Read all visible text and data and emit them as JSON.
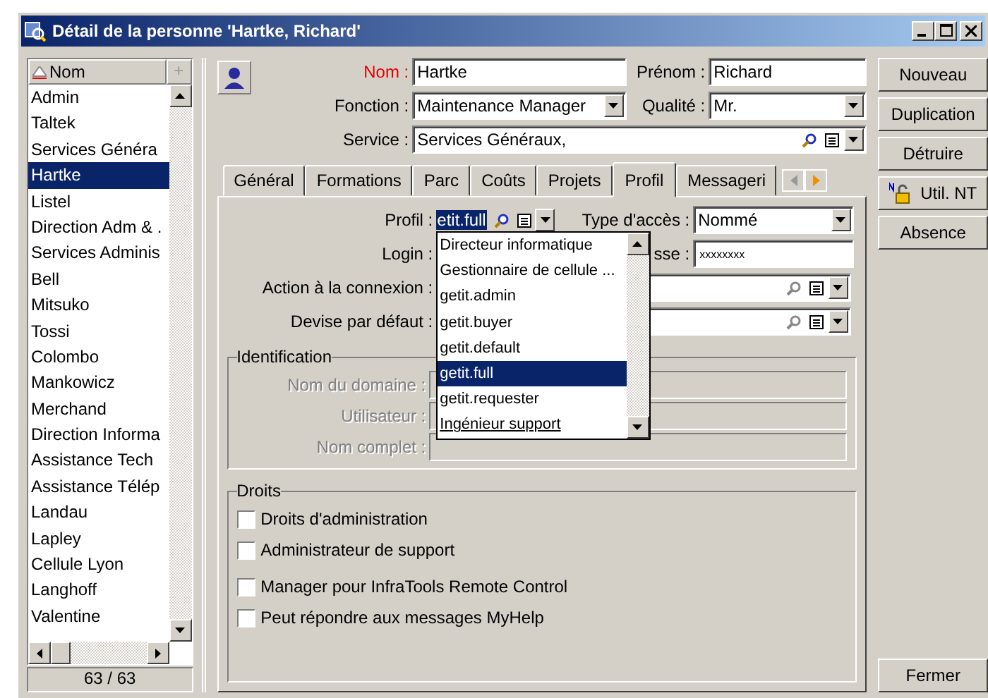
{
  "window": {
    "title": "Détail de la personne 'Hartke, Richard'"
  },
  "list": {
    "header": "Nom",
    "add_mark": "+",
    "counter": "63 / 63",
    "items": [
      {
        "label": "Admin",
        "selected": false
      },
      {
        "label": "Taltek",
        "selected": false
      },
      {
        "label": "Services Généra",
        "selected": false
      },
      {
        "label": "Hartke",
        "selected": true
      },
      {
        "label": "Listel",
        "selected": false
      },
      {
        "label": "Direction Adm & .",
        "selected": false
      },
      {
        "label": "Services Adminis",
        "selected": false
      },
      {
        "label": "Bell",
        "selected": false
      },
      {
        "label": "Mitsuko",
        "selected": false
      },
      {
        "label": "Tossi",
        "selected": false
      },
      {
        "label": "Colombo",
        "selected": false
      },
      {
        "label": "Mankowicz",
        "selected": false
      },
      {
        "label": "Merchand",
        "selected": false
      },
      {
        "label": "Direction Informa",
        "selected": false
      },
      {
        "label": "Assistance Tech",
        "selected": false
      },
      {
        "label": "Assistance Télép",
        "selected": false
      },
      {
        "label": "Landau",
        "selected": false
      },
      {
        "label": "Lapley",
        "selected": false
      },
      {
        "label": "Cellule Lyon",
        "selected": false
      },
      {
        "label": "Langhoff",
        "selected": false
      },
      {
        "label": "Valentine",
        "selected": false
      }
    ]
  },
  "header_fields": [
    [
      {
        "label": "Nom :",
        "value": "Hartke",
        "kind": "text",
        "required": true
      },
      {
        "label": "Prénom :",
        "value": "Richard",
        "kind": "text",
        "required": false
      }
    ],
    [
      {
        "label": "Fonction :",
        "value": "Maintenance Manager",
        "kind": "combo",
        "required": false
      },
      {
        "label": "Qualité :",
        "value": "Mr.",
        "kind": "combo",
        "required": false
      }
    ],
    [
      {
        "label": "Service :",
        "value": "Services Généraux,",
        "kind": "link",
        "required": false
      }
    ]
  ],
  "tabs": [
    {
      "label": "Général",
      "selected": false
    },
    {
      "label": "Formations",
      "selected": false
    },
    {
      "label": "Parc",
      "selected": false
    },
    {
      "label": "Coûts",
      "selected": false
    },
    {
      "label": "Projets",
      "selected": false
    },
    {
      "label": "Profil",
      "selected": true
    },
    {
      "label": "Messageri",
      "selected": false
    }
  ],
  "profile": {
    "profil_label": "Profil :",
    "profil_value": "etit.full",
    "access_label": "Type d'accès :",
    "access_value": "Nommé",
    "login_label": "Login :",
    "password_label": "sse :",
    "password_value": "xxxxxxxx",
    "action_label": "Action à la connexion :",
    "currency_label": "Devise par défaut :"
  },
  "dropdown": {
    "options": [
      {
        "label": "Directeur informatique",
        "selected": false
      },
      {
        "label": "Gestionnaire de cellule ...",
        "selected": false
      },
      {
        "label": "getit.admin",
        "selected": false
      },
      {
        "label": "getit.buyer",
        "selected": false
      },
      {
        "label": "getit.default",
        "selected": false
      },
      {
        "label": "getit.full",
        "selected": true
      },
      {
        "label": "getit.requester",
        "selected": false
      },
      {
        "label": "Ingénieur support",
        "selected": false
      }
    ]
  },
  "identification": {
    "title": "Identification",
    "fields": [
      {
        "label": "Nom du domaine :",
        "disabled": true
      },
      {
        "label": "Utilisateur :",
        "disabled": true
      },
      {
        "label": "Nom complet :",
        "disabled": true
      }
    ]
  },
  "rights": {
    "title": "Droits",
    "items": [
      {
        "label": "Droits d'administration",
        "checked": false
      },
      {
        "label": "Administrateur de support",
        "checked": false
      },
      {
        "label": "Manager pour InfraTools Remote Control",
        "checked": false
      },
      {
        "label": "Peut répondre aux messages MyHelp",
        "checked": false
      }
    ]
  },
  "buttons": [
    {
      "label": "Nouveau",
      "kind": "plain"
    },
    {
      "label": "Duplication",
      "kind": "plain"
    },
    {
      "label": "Détruire",
      "kind": "plain"
    },
    {
      "label": "Util. NT",
      "kind": "icon"
    },
    {
      "label": "Absence",
      "kind": "plain"
    }
  ],
  "close_button": "Fermer"
}
